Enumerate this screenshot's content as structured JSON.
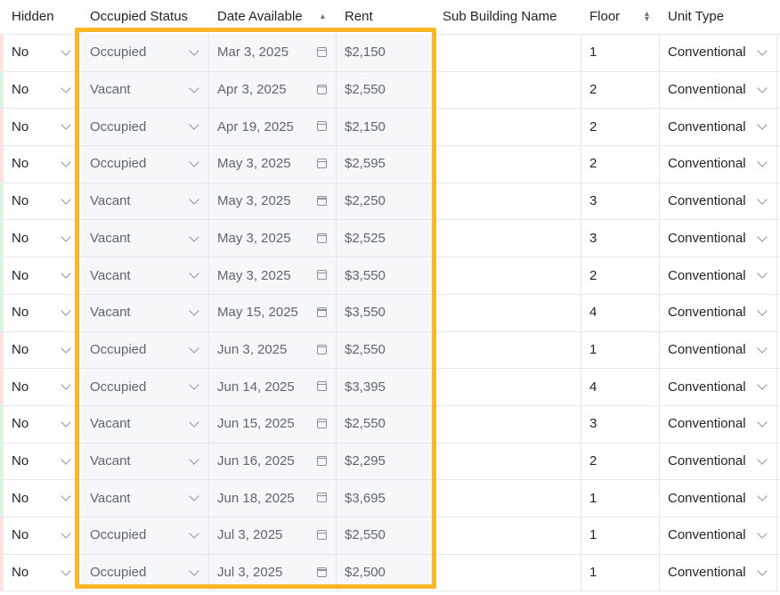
{
  "columns": {
    "hidden": "Hidden",
    "occupied_status": "Occupied Status",
    "date_available": "Date Available",
    "rent": "Rent",
    "sub_building_name": "Sub Building Name",
    "floor": "Floor",
    "unit_type": "Unit Type"
  },
  "sort": {
    "date_available": "ascending",
    "floor": "unsorted"
  },
  "colors": {
    "selection_border": "#fdb628",
    "occupied_stripe": "#fde2e2",
    "vacant_stripe": "#dcf5e3"
  },
  "rows": [
    {
      "hidden": "No",
      "status": "Occupied",
      "date": "Mar 3, 2025",
      "rent": "$2,150",
      "sub_building": "",
      "floor": "1",
      "unit_type": "Conventional"
    },
    {
      "hidden": "No",
      "status": "Vacant",
      "date": "Apr 3, 2025",
      "rent": "$2,550",
      "sub_building": "",
      "floor": "2",
      "unit_type": "Conventional"
    },
    {
      "hidden": "No",
      "status": "Occupied",
      "date": "Apr 19, 2025",
      "rent": "$2,150",
      "sub_building": "",
      "floor": "2",
      "unit_type": "Conventional"
    },
    {
      "hidden": "No",
      "status": "Occupied",
      "date": "May 3, 2025",
      "rent": "$2,595",
      "sub_building": "",
      "floor": "2",
      "unit_type": "Conventional"
    },
    {
      "hidden": "No",
      "status": "Vacant",
      "date": "May 3, 2025",
      "rent": "$2,250",
      "sub_building": "",
      "floor": "3",
      "unit_type": "Conventional"
    },
    {
      "hidden": "No",
      "status": "Vacant",
      "date": "May 3, 2025",
      "rent": "$2,525",
      "sub_building": "",
      "floor": "3",
      "unit_type": "Conventional"
    },
    {
      "hidden": "No",
      "status": "Vacant",
      "date": "May 3, 2025",
      "rent": "$3,550",
      "sub_building": "",
      "floor": "2",
      "unit_type": "Conventional"
    },
    {
      "hidden": "No",
      "status": "Vacant",
      "date": "May 15, 2025",
      "rent": "$3,550",
      "sub_building": "",
      "floor": "4",
      "unit_type": "Conventional"
    },
    {
      "hidden": "No",
      "status": "Occupied",
      "date": "Jun 3, 2025",
      "rent": "$2,550",
      "sub_building": "",
      "floor": "1",
      "unit_type": "Conventional"
    },
    {
      "hidden": "No",
      "status": "Occupied",
      "date": "Jun 14, 2025",
      "rent": "$3,395",
      "sub_building": "",
      "floor": "4",
      "unit_type": "Conventional"
    },
    {
      "hidden": "No",
      "status": "Vacant",
      "date": "Jun 15, 2025",
      "rent": "$2,550",
      "sub_building": "",
      "floor": "3",
      "unit_type": "Conventional"
    },
    {
      "hidden": "No",
      "status": "Vacant",
      "date": "Jun 16, 2025",
      "rent": "$2,295",
      "sub_building": "",
      "floor": "2",
      "unit_type": "Conventional"
    },
    {
      "hidden": "No",
      "status": "Vacant",
      "date": "Jun 18, 2025",
      "rent": "$3,695",
      "sub_building": "",
      "floor": "1",
      "unit_type": "Conventional"
    },
    {
      "hidden": "No",
      "status": "Occupied",
      "date": "Jul 3, 2025",
      "rent": "$2,550",
      "sub_building": "",
      "floor": "1",
      "unit_type": "Conventional"
    },
    {
      "hidden": "No",
      "status": "Occupied",
      "date": "Jul 3, 2025",
      "rent": "$2,500",
      "sub_building": "",
      "floor": "1",
      "unit_type": "Conventional"
    }
  ]
}
